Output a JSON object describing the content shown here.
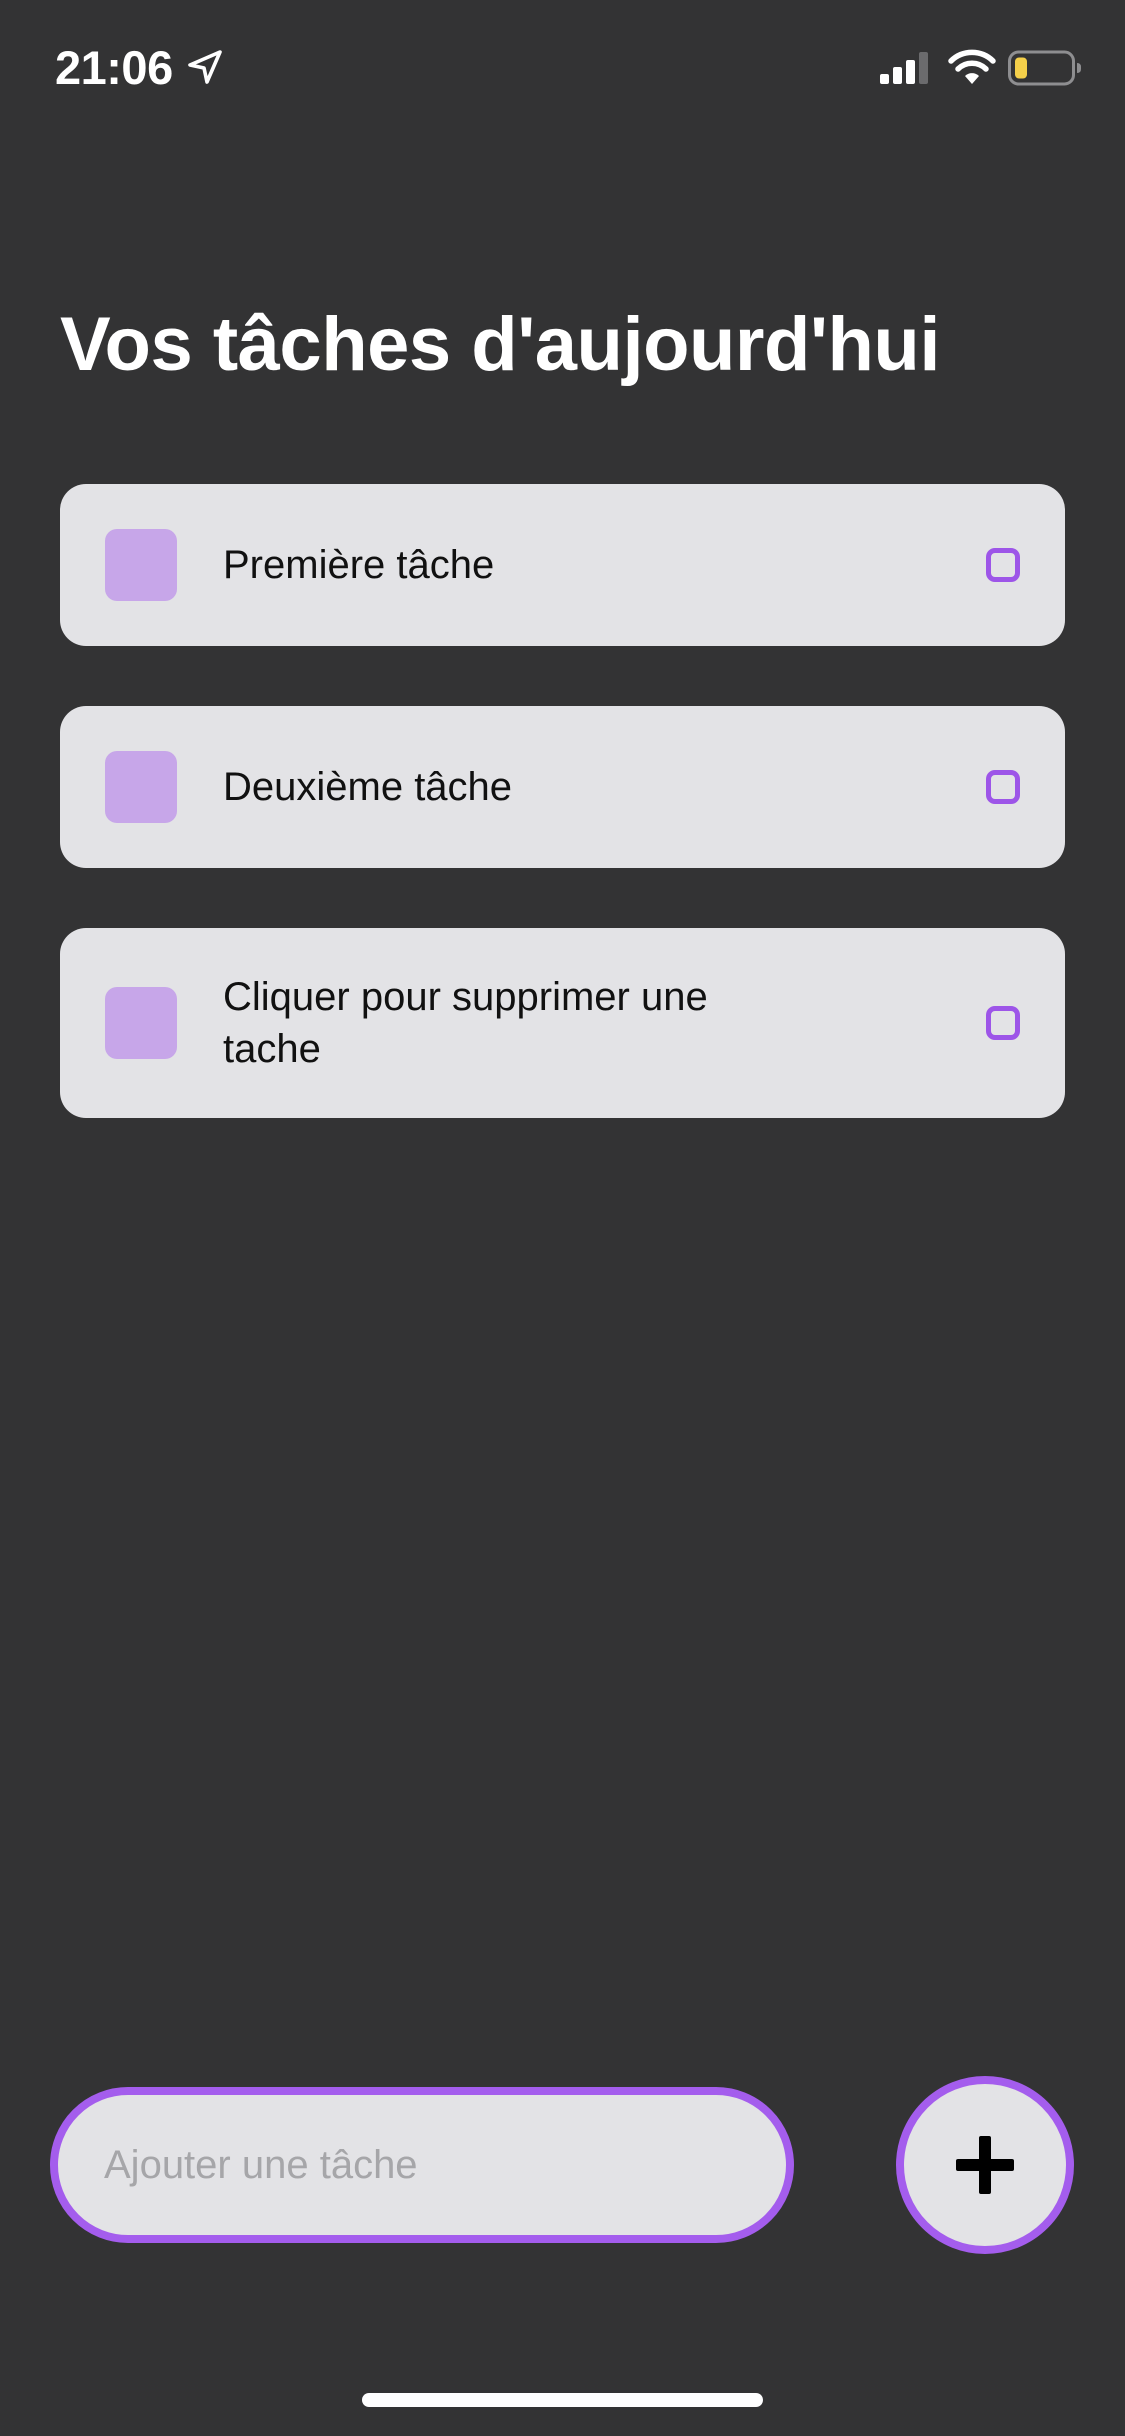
{
  "status_bar": {
    "time": "21:06",
    "icons": [
      "location-arrow-icon",
      "cellular-signal-icon",
      "wifi-icon",
      "battery-low-icon"
    ]
  },
  "header": {
    "title": "Vos tâches d'aujourd'hui"
  },
  "tasks": [
    {
      "label": "Première tâche"
    },
    {
      "label": "Deuxième tâche"
    },
    {
      "label": "Cliquer pour supprimer une tache"
    }
  ],
  "composer": {
    "placeholder": "Ajouter une tâche",
    "value": "",
    "add_icon": "plus-icon"
  },
  "colors": {
    "background": "#333334",
    "card": "#e3e3e6",
    "accent": "#a45ded",
    "task_square": "#c7a6e9",
    "battery_fill": "#f5d04a"
  }
}
